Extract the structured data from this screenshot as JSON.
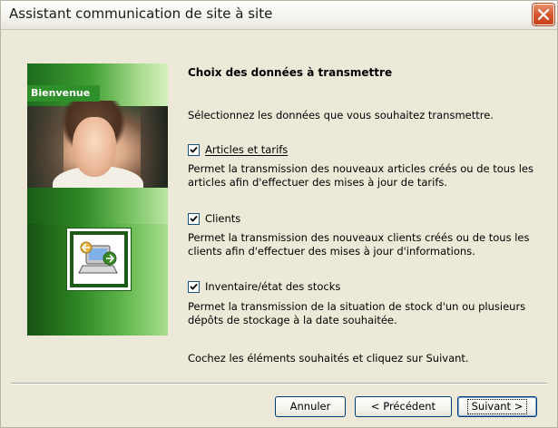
{
  "window": {
    "title": "Assistant communication de site à site"
  },
  "banner": {
    "label": "Bienvenue"
  },
  "main": {
    "heading": "Choix des données à transmettre",
    "intro": "Sélectionnez les données que vous souhaitez transmettre.",
    "options": [
      {
        "label": "Articles et tarifs",
        "checked": true,
        "description": "Permet la transmission des nouveaux articles créés ou de tous les articles afin d'effectuer des mises à jour de tarifs."
      },
      {
        "label": "Clients",
        "checked": true,
        "description": "Permet la transmission des nouveaux clients créés ou de tous les clients afin d'effectuer des mises à jour d'informations."
      },
      {
        "label": "Inventaire/état des stocks",
        "checked": true,
        "description": "Permet la transmission de la situation de stock d'un ou plusieurs dépôts de stockage à la date souhaitée."
      }
    ],
    "footer": "Cochez les éléments souhaités et cliquez sur Suivant."
  },
  "buttons": {
    "cancel": "Annuler",
    "previous": "< Précédent",
    "next": "Suivant >"
  },
  "colors": {
    "window_bg": "#ece9d8",
    "banner_green": "#2f8f2a",
    "close_red": "#d5572e"
  }
}
